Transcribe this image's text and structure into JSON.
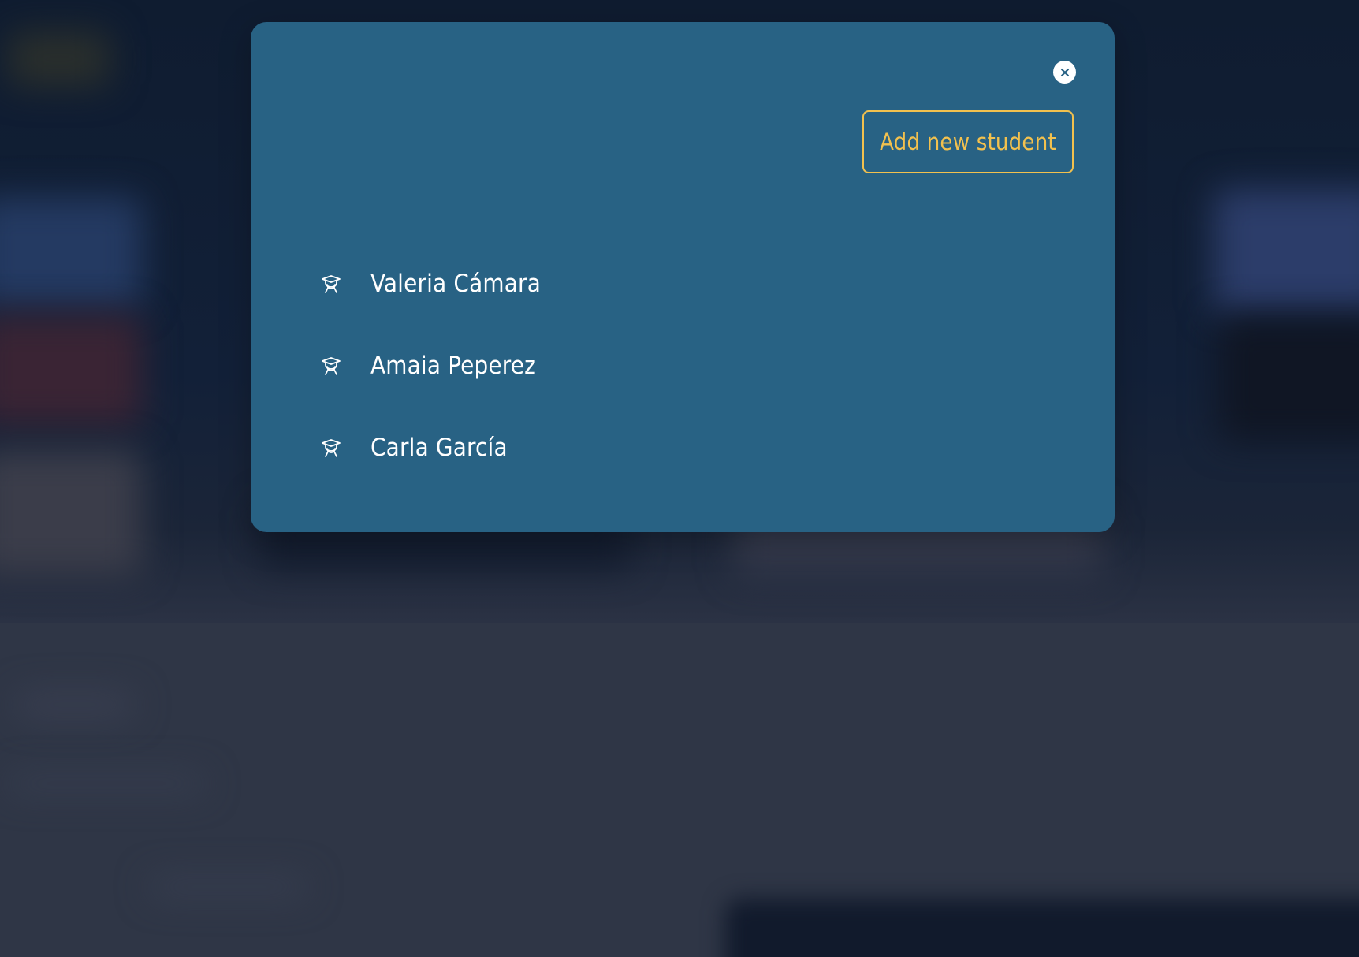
{
  "modal": {
    "close_icon": "close-icon",
    "add_button_label": "Add new student",
    "students": [
      {
        "name": "Valeria Cámara",
        "icon": "graduate-icon"
      },
      {
        "name": "Amaia Peperez",
        "icon": "graduate-icon"
      },
      {
        "name": "Carla García",
        "icon": "graduate-icon"
      }
    ]
  },
  "colors": {
    "modal_background": "#286284",
    "accent": "#f2c14e",
    "text": "#ffffff",
    "page_background": "#0f1c30"
  }
}
